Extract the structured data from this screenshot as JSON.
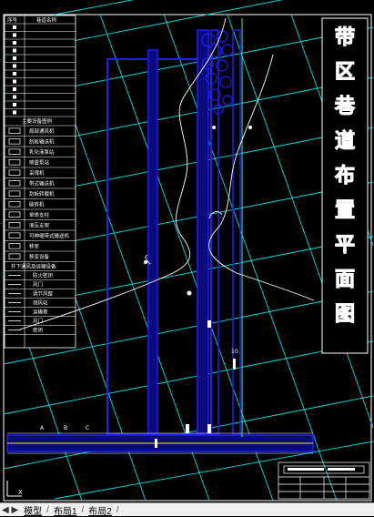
{
  "title": {
    "chars": [
      "带",
      "区",
      "巷",
      "道",
      "布",
      "置",
      "平",
      "面",
      "图"
    ]
  },
  "legend": {
    "header": [
      "序号",
      "巷道名称"
    ],
    "rows_top": [
      "",
      "",
      "",
      "",
      "",
      "",
      "",
      "",
      "",
      "",
      "",
      ""
    ],
    "section_label": "主要设备图例",
    "rows_equipment": [
      "局部通风机",
      "刮板输送机",
      "乳化液泵站",
      "喷雾泵站",
      "采煤机",
      "带式输送机",
      "刮板转载机",
      "破碎机",
      "单体支柱",
      "液压支架",
      "可伸缩带式输送机",
      "移变",
      "移变设备"
    ],
    "section_label2": "井下通风及运输设备",
    "rows_bottom": [
      "防火密闭",
      "风门",
      "调节风窗",
      "测风站",
      "运输巷",
      "风门",
      "密闭"
    ]
  },
  "markers": {
    "bottom_labels": [
      "A",
      "B",
      "C"
    ],
    "station_label": "10"
  },
  "colors": {
    "background": "#000000",
    "grid": "#00e0e0",
    "roadway": "#1e1eff",
    "roadway_fill": "#0a0a7a",
    "boundary": "#ffffff",
    "rail": "#f0f000",
    "green_line": "#40ff40"
  },
  "tabs": {
    "model": "模型",
    "layout1": "布局1",
    "layout2": "布局2"
  }
}
